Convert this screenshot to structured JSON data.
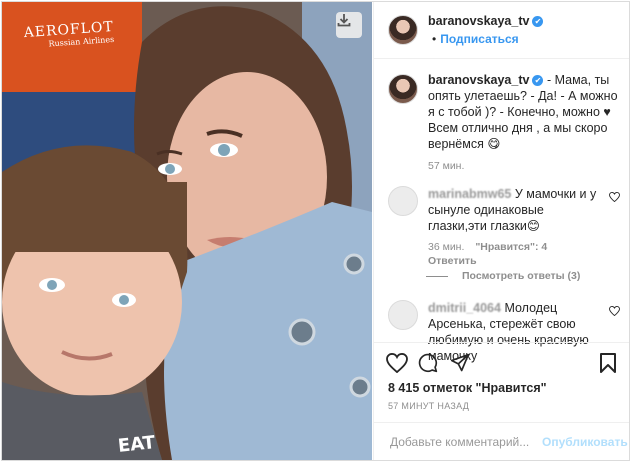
{
  "photo": {
    "shirt_brand": "AEROFLOT",
    "shirt_sub": "Russian Airlines",
    "boy_shirt_text": "EAT"
  },
  "post": {
    "username": "baranovskaya_tv",
    "verified_icon": "✔",
    "separator": "•",
    "follow_label": "Подписаться"
  },
  "caption": {
    "username": "baranovskaya_tv",
    "text": "- Мама, ты опять улетаешь? - Да! - А можно я с тобой )? - Конечно, можно ♥",
    "text2": "Всем отлично дня , а мы скоро вернёмся 😋",
    "time": "57 мин."
  },
  "comments": [
    {
      "username": "marinabmw65",
      "text": "У мамочки и у сынуле одинаковые глазки,эти глазки😊",
      "time": "36 мин.",
      "likes": "\"Нравится\": 4",
      "reply": "Ответить"
    },
    {
      "username": "dmitrii_4064",
      "text": "Молодец Арсенька, стережёт свою любимую и очень красивую мамочку"
    }
  ],
  "view_replies": "Посмотреть ответы (3)",
  "actions": {
    "likes_text": "8 415 отметок \"Нравится\"",
    "timestamp": "57 МИНУТ НАЗАД"
  },
  "add_comment": {
    "placeholder": "Добавьте комментарий...",
    "publish_label": "Опубликовать"
  },
  "colors": {
    "accent": "#3897f0",
    "muted": "#8e8e8e",
    "publish_disabled": "#b2dffc",
    "shirt_orange": "#d9521f"
  }
}
